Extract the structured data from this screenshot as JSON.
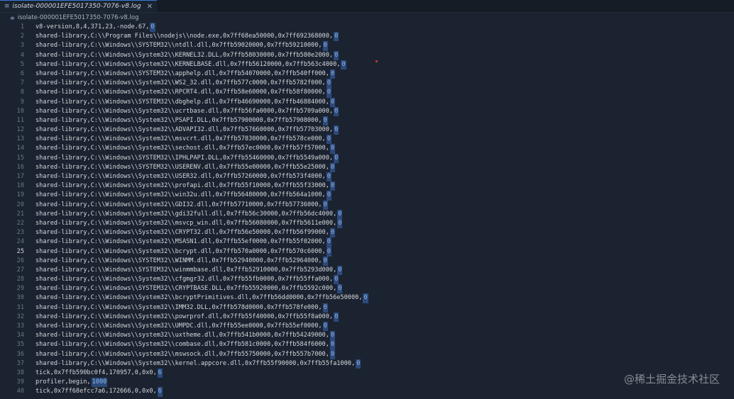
{
  "tab": {
    "title": "isolate-000001EFE5017350-7076-v8.log",
    "close": "✕",
    "icon": "file-icon"
  },
  "breadcrumb": {
    "file": "isolate-000001EFE5017350-7076-v8.log",
    "icon": "file-icon"
  },
  "watermark": "@稀土掘金技术社区",
  "active_line": 25,
  "lines": [
    "v8-version,8,4,371,23,-node.67,0",
    "shared-library,C:\\\\Program Files\\\\nodejs\\\\node.exe,0x7ff68ea50000,0x7ff692368000,0",
    "shared-library,C:\\\\Windows\\\\SYSTEM32\\\\ntdll.dll,0x7ffb59020000,0x7ffb59210000,0",
    "shared-library,C:\\\\Windows\\\\System32\\\\KERNEL32.DLL,0x7ffb58030000,0x7ffb580e2000,0",
    "shared-library,C:\\\\Windows\\\\System32\\\\KERNELBASE.dll,0x7ffb56120000,0x7ffb563c4000,0",
    "shared-library,C:\\\\Windows\\\\SYSTEM32\\\\apphelp.dll,0x7ffb54070000,0x7ffb540ff000,0",
    "shared-library,C:\\\\Windows\\\\System32\\\\WS2_32.dll,0x7ffb577c0000,0x7ffb5782f000,0",
    "shared-library,C:\\\\Windows\\\\System32\\\\RPCRT4.dll,0x7ffb58e60000,0x7ffb58f80000,0",
    "shared-library,C:\\\\Windows\\\\SYSTEM32\\\\dbghelp.dll,0x7ffb46690000,0x7ffb46884000,0",
    "shared-library,C:\\\\Windows\\\\System32\\\\ucrtbase.dll,0x7ffb56fa0000,0x7ffb5709a000,0",
    "shared-library,C:\\\\Windows\\\\System32\\\\PSAPI.DLL,0x7ffb57900000,0x7ffb57908000,0",
    "shared-library,C:\\\\Windows\\\\System32\\\\ADVAPI32.dll,0x7ffb57660000,0x7ffb57703000,0",
    "shared-library,C:\\\\Windows\\\\System32\\\\msvcrt.dll,0x7ffb57830000,0x7ffb578ce000,0",
    "shared-library,C:\\\\Windows\\\\System32\\\\sechost.dll,0x7ffb57ec0000,0x7ffb57f57000,0",
    "shared-library,C:\\\\Windows\\\\SYSTEM32\\\\IPHLPAPI.DLL,0x7ffb55460000,0x7ffb5549a000,0",
    "shared-library,C:\\\\Windows\\\\SYSTEM32\\\\USERENV.dll,0x7ffb55e00000,0x7ffb55e25000,0",
    "shared-library,C:\\\\Windows\\\\System32\\\\USER32.dll,0x7ffb57260000,0x7ffb573f4000,0",
    "shared-library,C:\\\\Windows\\\\System32\\\\profapi.dll,0x7ffb55f10000,0x7ffb55f33000,0",
    "shared-library,C:\\\\Windows\\\\System32\\\\win32u.dll,0x7ffb56480000,0x7ffb564a1000,0",
    "shared-library,C:\\\\Windows\\\\System32\\\\GDI32.dll,0x7ffb57710000,0x7ffb57736000,0",
    "shared-library,C:\\\\Windows\\\\System32\\\\gdi32full.dll,0x7ffb56c30000,0x7ffb56dc4000,0",
    "shared-library,C:\\\\Windows\\\\System32\\\\msvcp_win.dll,0x7ffb56080000,0x7ffb5611e000,0",
    "shared-library,C:\\\\Windows\\\\System32\\\\CRYPT32.dll,0x7ffb56e50000,0x7ffb56f99000,0",
    "shared-library,C:\\\\Windows\\\\System32\\\\MSASN1.dll,0x7ffb55ef0000,0x7ffb55f02000,0",
    "shared-library,C:\\\\Windows\\\\System32\\\\bcrypt.dll,0x7ffb570a0000,0x7ffb570c6000,0",
    "shared-library,C:\\\\Windows\\\\SYSTEM32\\\\WINMM.dll,0x7ffb52940000,0x7ffb52964000,0",
    "shared-library,C:\\\\Windows\\\\SYSTEM32\\\\winmmbase.dll,0x7ffb52910000,0x7ffb5293d000,0",
    "shared-library,C:\\\\Windows\\\\System32\\\\cfgmgr32.dll,0x7ffb55fb0000,0x7ffb55ffa000,0",
    "shared-library,C:\\\\Windows\\\\SYSTEM32\\\\CRYPTBASE.DLL,0x7ffb55920000,0x7ffb5592c000,0",
    "shared-library,C:\\\\Windows\\\\System32\\\\bcryptPrimitives.dll,0x7ffb56dd0000,0x7ffb56e50000,0",
    "shared-library,C:\\\\Windows\\\\System32\\\\IMM32.DLL,0x7ffb578d0000,0x7ffb578fe000,0",
    "shared-library,C:\\\\Windows\\\\System32\\\\powrprof.dll,0x7ffb55f40000,0x7ffb55f8a000,0",
    "shared-library,C:\\\\Windows\\\\System32\\\\UMPDC.dll,0x7ffb55ee0000,0x7ffb55ef0000,0",
    "shared-library,C:\\\\Windows\\\\system32\\\\uxtheme.dll,0x7ffb541b0000,0x7ffb54249000,0",
    "shared-library,C:\\\\Windows\\\\System32\\\\combase.dll,0x7ffb581c0000,0x7ffb584f6000,0",
    "shared-library,C:\\\\Windows\\\\system32\\\\mswsock.dll,0x7ffb55750000,0x7ffb557b7000,0",
    "shared-library,C:\\\\Windows\\\\System32\\\\kernel.appcore.dll,0x7ffb55f90000,0x7ffb55fa1000,0",
    "tick,0x7ffb590bc0f4,170957,0,0x0,6",
    "profiler,begin,1000",
    "tick,0x7ff68efcc7a6,172666,0,0x0,6"
  ]
}
